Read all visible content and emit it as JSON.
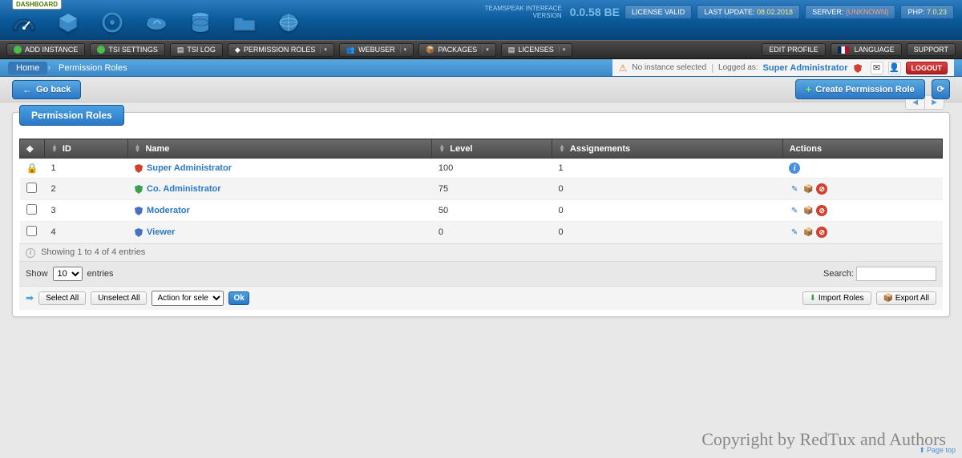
{
  "header": {
    "dash_tab": "DASHBOARD",
    "product_line1": "TEAMSPEAK INTERFACE",
    "product_line2": "VERSION",
    "version": "0.0.58 BE",
    "license": "LICENSE VALID",
    "last_update_label": "LAST UPDATE:",
    "last_update_val": "08.02.2018",
    "server_label": "SERVER:",
    "server_val": "(UNKNOWN)",
    "php_label": "PHP:",
    "php_val": "7.0.23"
  },
  "toolbar": {
    "add_instance": "ADD INSTANCE",
    "tsi_settings": "TSI SETTINGS",
    "tsi_log": "TSI LOG",
    "permission_roles": "PERMISSION ROLES",
    "webuser": "WEBUSER",
    "packages": "PACKAGES",
    "licenses": "LICENSES",
    "edit_profile": "EDIT PROFILE",
    "language": "LANGUAGE",
    "support": "SUPPORT"
  },
  "breadcrumb": {
    "home": "Home",
    "current": "Permission Roles",
    "no_instance": "No instance selected",
    "logged_as": "Logged as:",
    "user": "Super Administrator",
    "logout": "LOGOUT"
  },
  "actions": {
    "go_back": "Go back",
    "create": "Create Permission Role"
  },
  "panel": {
    "title": "Permission Roles",
    "cols": {
      "id": "ID",
      "name": "Name",
      "level": "Level",
      "assign": "Assignements",
      "actions": "Actions"
    },
    "rows": [
      {
        "id": "1",
        "name": "Super Administrator",
        "level": "100",
        "assign": "1",
        "locked": true,
        "shield": "#d04030"
      },
      {
        "id": "2",
        "name": "Co. Administrator",
        "level": "75",
        "assign": "0",
        "locked": false,
        "shield": "#3aa050"
      },
      {
        "id": "3",
        "name": "Moderator",
        "level": "50",
        "assign": "0",
        "locked": false,
        "shield": "#4a70c0"
      },
      {
        "id": "4",
        "name": "Viewer",
        "level": "0",
        "assign": "0",
        "locked": false,
        "shield": "#4a70c0"
      }
    ],
    "info": "Showing 1 to 4 of 4 entries",
    "show": "Show",
    "entries": "entries",
    "entries_opts": [
      "10"
    ],
    "search": "Search:",
    "select_all": "Select All",
    "unselect_all": "Unselect All",
    "action_selected": "Action for selected...",
    "ok": "Ok",
    "import": "Import Roles",
    "export": "Export All"
  },
  "footer": "Copyright by RedTux and Authors",
  "page_top": "Page top"
}
